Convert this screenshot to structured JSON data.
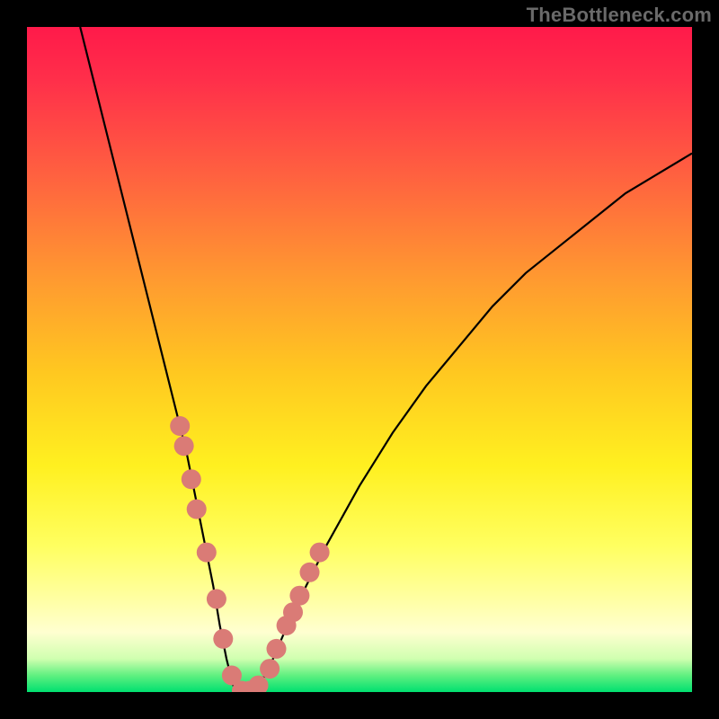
{
  "watermark": "TheBottleneck.com",
  "colors": {
    "frame": "#000000",
    "curve": "#000000",
    "marker": "#da7b76",
    "gradient_top": "#ff1a4a",
    "gradient_bottom": "#00e070"
  },
  "chart_data": {
    "type": "line",
    "title": "",
    "xlabel": "",
    "ylabel": "",
    "xlim": [
      0,
      100
    ],
    "ylim": [
      0,
      100
    ],
    "grid": false,
    "series": [
      {
        "name": "bottleneck-curve",
        "x": [
          8,
          10,
          12,
          14,
          16,
          18,
          20,
          22,
          24,
          26,
          27,
          28,
          29,
          30,
          31,
          32,
          33,
          34,
          35,
          37,
          40,
          45,
          50,
          55,
          60,
          65,
          70,
          75,
          80,
          85,
          90,
          95,
          100
        ],
        "y": [
          100,
          92,
          84,
          76,
          68,
          60,
          52,
          44,
          36,
          26,
          21,
          16,
          10,
          5,
          1,
          0,
          0,
          0,
          1,
          5,
          12,
          22,
          31,
          39,
          46,
          52,
          58,
          63,
          67,
          71,
          75,
          78,
          81
        ]
      }
    ],
    "markers": {
      "name": "highlight-dots",
      "color": "#da7b76",
      "x": [
        23.0,
        23.6,
        24.7,
        25.5,
        27.0,
        28.5,
        29.5,
        30.8,
        32.3,
        33.5,
        34.8,
        36.5,
        37.5,
        39.0,
        40.0,
        41.0,
        42.5,
        44.0
      ],
      "y": [
        40.0,
        37.0,
        32.0,
        27.5,
        21.0,
        14.0,
        8.0,
        2.5,
        0.2,
        0.2,
        1.0,
        3.5,
        6.5,
        10.0,
        12.0,
        14.5,
        18.0,
        21.0
      ]
    }
  }
}
